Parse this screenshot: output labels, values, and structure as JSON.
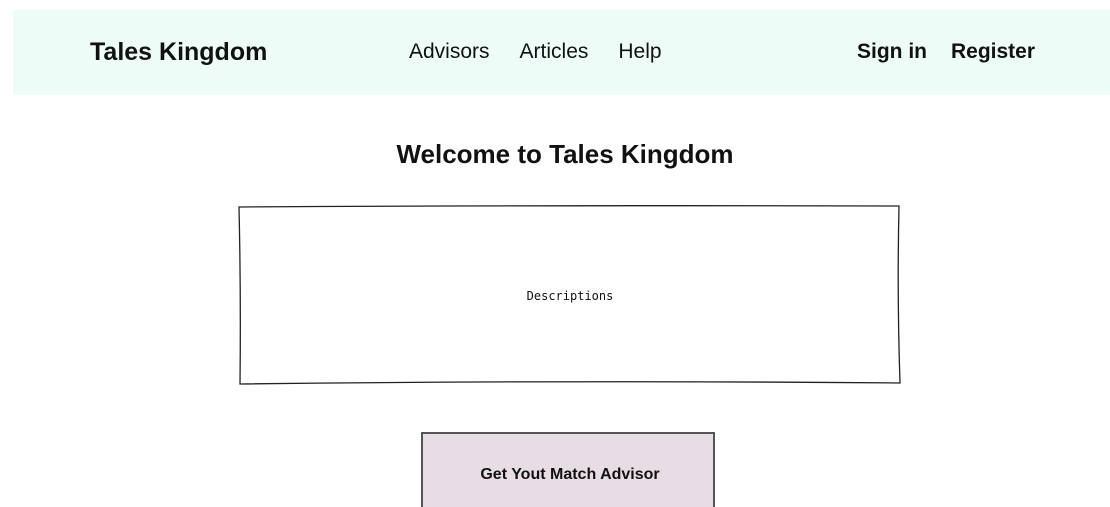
{
  "header": {
    "brand": "Tales Kingdom",
    "nav": [
      "Advisors",
      "Articles",
      "Help"
    ],
    "sign_in": "Sign in",
    "register": "Register"
  },
  "main": {
    "title": "Welcome to Tales Kingdom",
    "description": "Descriptions",
    "cta_label": "Get Yout Match Advisor"
  },
  "colors": {
    "header_bg": "#eefcf8",
    "cta_bg": "#e8dde4",
    "cta_border": "#555555"
  }
}
